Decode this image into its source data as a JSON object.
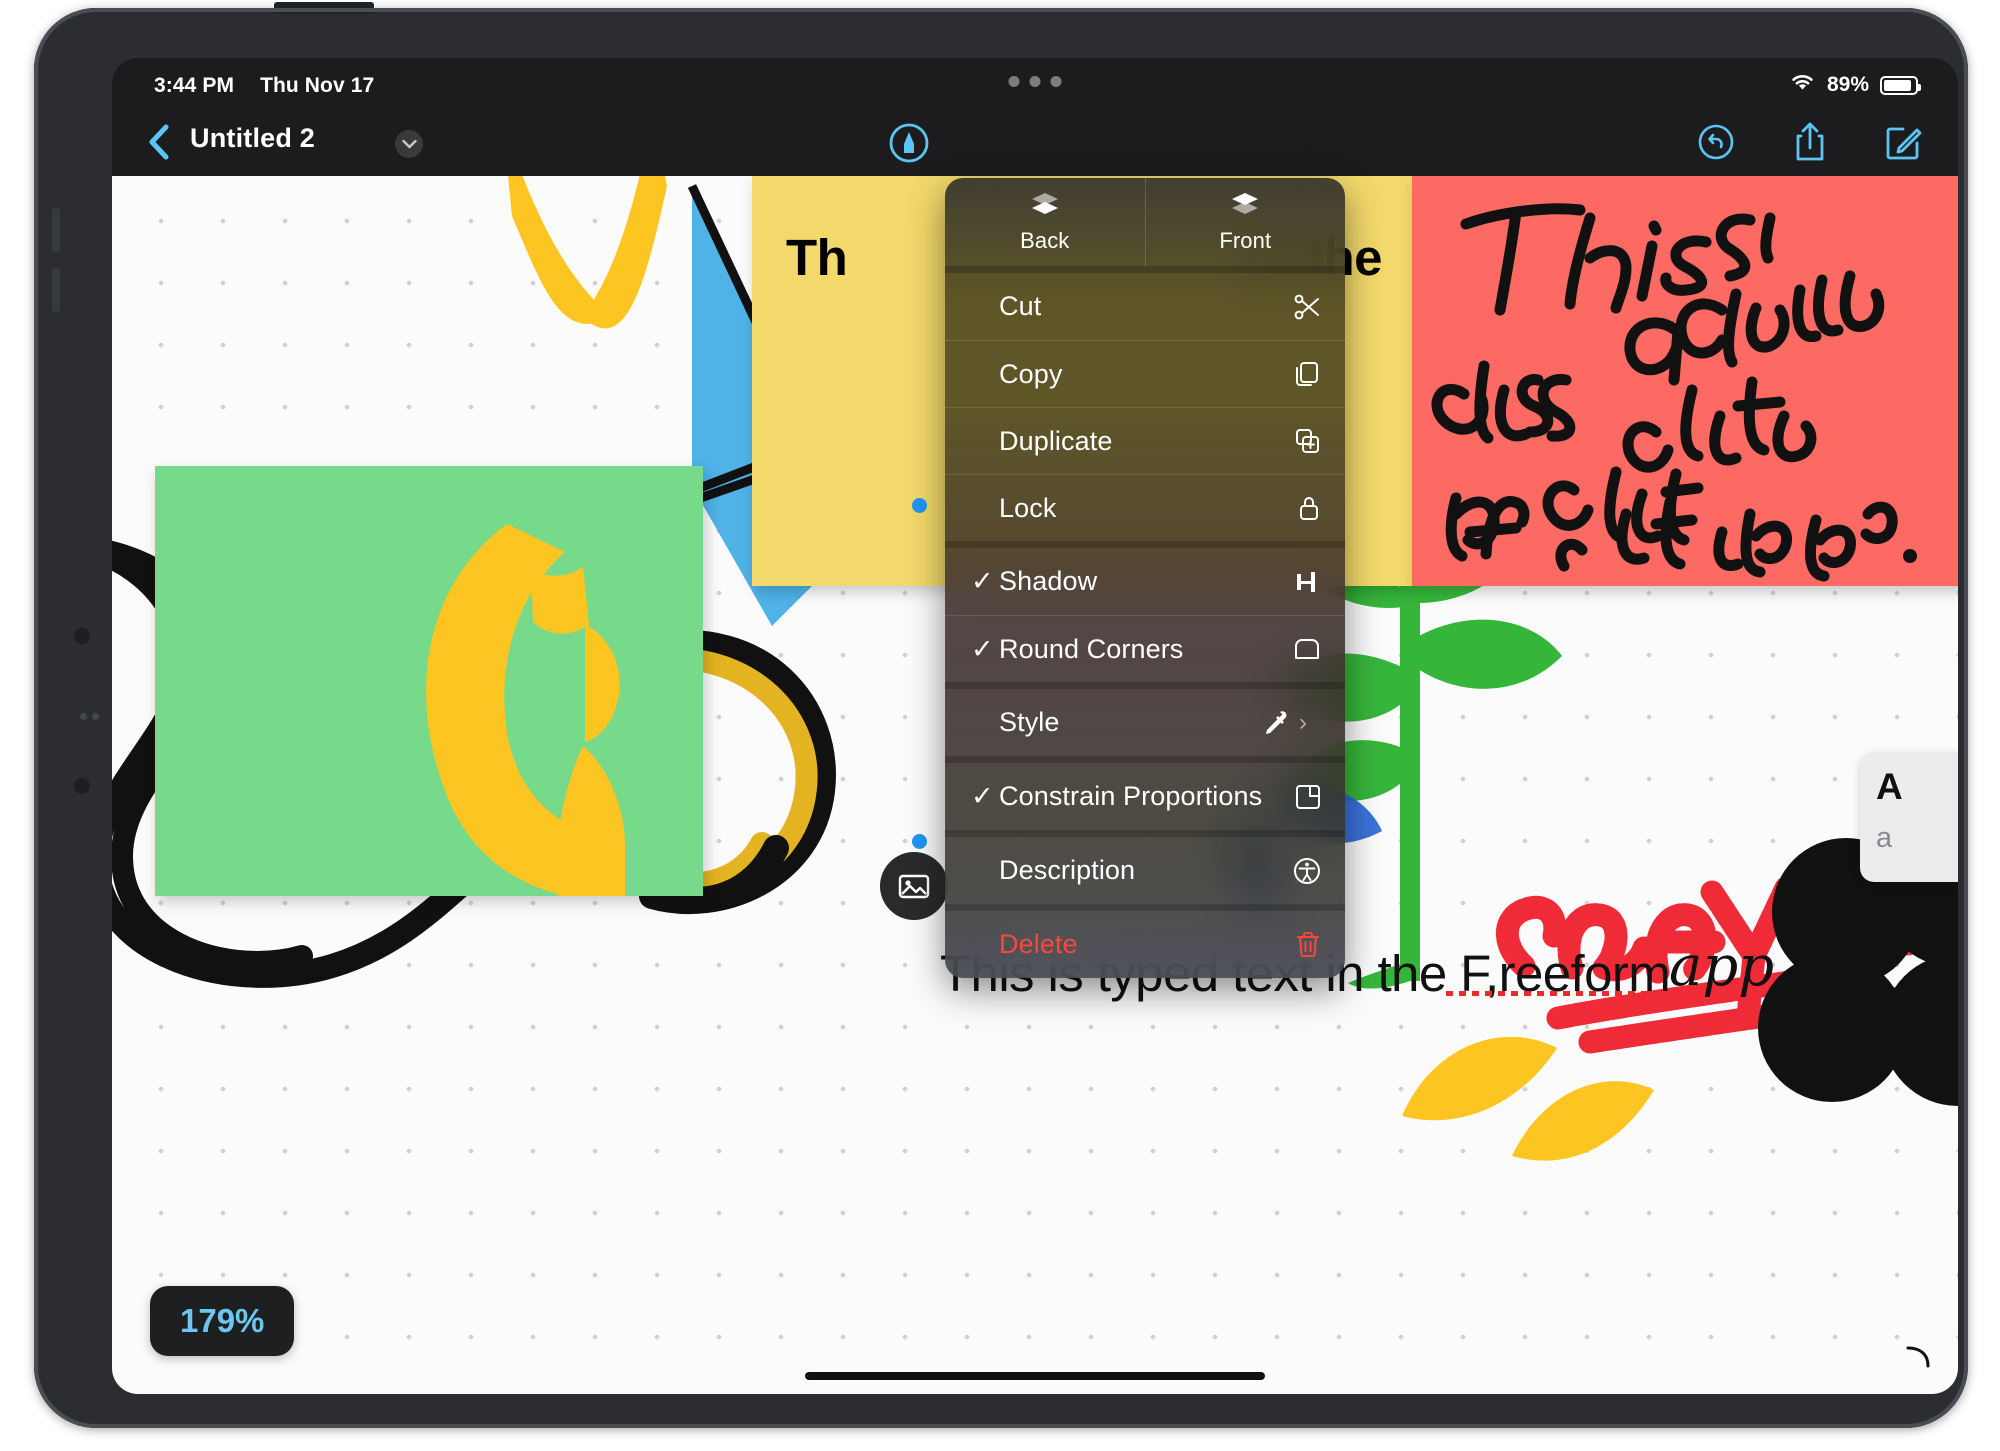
{
  "status_bar": {
    "time": "3:44 PM",
    "date": "Thu Nov 17",
    "battery_percent": "89%",
    "wifi_icon": "wifi-icon",
    "battery_icon": "battery-icon",
    "multitask_handle_icon": "multitask-handle-icon"
  },
  "toolbar": {
    "back_icon": "chevron-left-icon",
    "title": "Untitled 2",
    "title_chevron_icon": "chevron-down-icon",
    "markup_pen_icon": "markup-pen-icon",
    "undo_icon": "undo-icon",
    "share_icon": "share-icon",
    "insert_icon": "compose-icon"
  },
  "context_menu": {
    "header": [
      {
        "label": "Back",
        "icon": "send-to-back-icon"
      },
      {
        "label": "Front",
        "icon": "bring-to-front-icon"
      }
    ],
    "groups": [
      [
        {
          "label": "Cut",
          "icon": "scissors-icon",
          "checked": false,
          "destructive": false,
          "submenu": false
        },
        {
          "label": "Copy",
          "icon": "copy-icon",
          "checked": false,
          "destructive": false,
          "submenu": false
        },
        {
          "label": "Duplicate",
          "icon": "duplicate-icon",
          "checked": false,
          "destructive": false,
          "submenu": false
        },
        {
          "label": "Lock",
          "icon": "lock-icon",
          "checked": false,
          "destructive": false,
          "submenu": false
        }
      ],
      [
        {
          "label": "Shadow",
          "icon": "shadow-icon",
          "checked": true,
          "destructive": false,
          "submenu": false
        },
        {
          "label": "Round Corners",
          "icon": "round-corners-icon",
          "checked": true,
          "destructive": false,
          "submenu": false
        }
      ],
      [
        {
          "label": "Style",
          "icon": "eyedropper-icon",
          "checked": false,
          "destructive": false,
          "submenu": true
        }
      ],
      [
        {
          "label": "Constrain Proportions",
          "icon": "constrain-proportions-icon",
          "checked": true,
          "destructive": false,
          "submenu": false
        }
      ],
      [
        {
          "label": "Description",
          "icon": "accessibility-icon",
          "checked": false,
          "destructive": false,
          "submenu": false
        }
      ],
      [
        {
          "label": "Delete",
          "icon": "trash-icon",
          "checked": false,
          "destructive": true,
          "submenu": false
        }
      ]
    ],
    "checkmark_glyph": "✓",
    "submenu_chevron_glyph": "›"
  },
  "canvas": {
    "zoom_level": "179%",
    "sticky_notes": [
      {
        "name": "yellow-sticky-note",
        "color": "#F3D96B",
        "text_left": "Th",
        "text_right": "in the"
      },
      {
        "name": "coral-sticky-note",
        "color": "#FC6A63",
        "handwriting": "This is also a sticky note in the freeform app."
      },
      {
        "name": "green-sticky-note",
        "color": "#77D98A",
        "content": "yellow brush stroke"
      }
    ],
    "typed_text": "This is typed text in the F,reeform",
    "typed_text_misspelled_word": "F,reeform",
    "script_text": "app",
    "crayon_drawing_text": "crayon",
    "link_card": {
      "title": "A",
      "subtitle": "a"
    },
    "photo_badge_icon": "photo-icon",
    "selection_handle_icon": "selection-handle-icon",
    "page_curl_icon": "page-curl-icon",
    "home_indicator_icon": "home-indicator"
  },
  "colors": {
    "accent_blue": "#5bc6f5",
    "destructive_red": "#ff463a",
    "zoom_badge_text": "#6cc6f2",
    "sticky_yellow": "#F3D96B",
    "sticky_coral": "#FC6A63",
    "sticky_green": "#77D98A",
    "crayon_red": "#EE2B37",
    "leaf_green": "#36B53B",
    "brush_yellow": "#FCC521",
    "shape_blue": "#4FB3E8"
  }
}
